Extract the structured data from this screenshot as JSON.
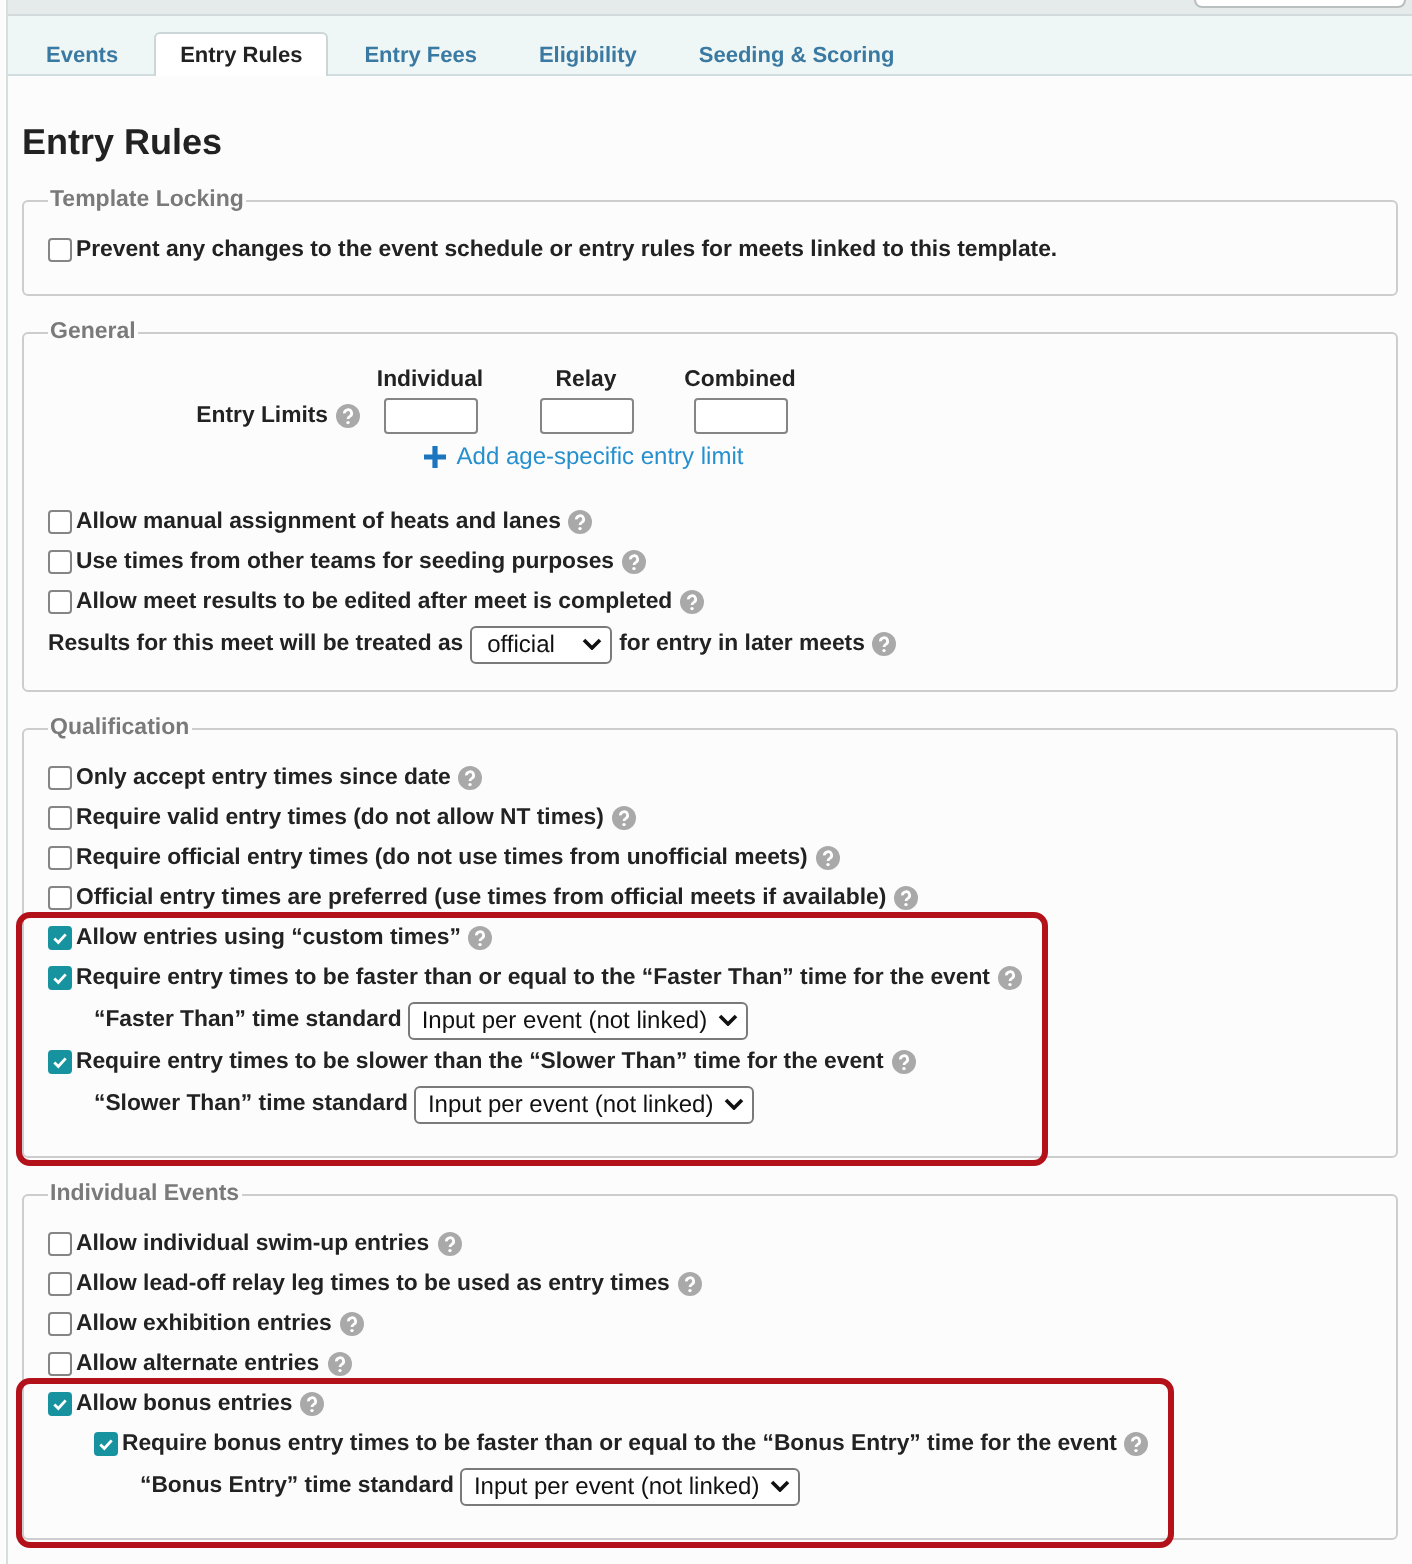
{
  "tabs": [
    {
      "label": "Events",
      "selected": false
    },
    {
      "label": "Entry Rules",
      "selected": true
    },
    {
      "label": "Entry Fees",
      "selected": false
    },
    {
      "label": "Eligibility",
      "selected": false
    },
    {
      "label": "Seeding & Scoring",
      "selected": false
    }
  ],
  "heading": "Entry Rules",
  "sections": [
    {
      "legend": "Template Locking",
      "groups": [
        {
          "highlighted": false,
          "rows": [
            {
              "kind": "checkbox",
              "label": "Prevent any changes to the event schedule or entry rules for meets linked to this template.",
              "checked": false,
              "help": false
            }
          ]
        }
      ]
    },
    {
      "legend": "General",
      "groups": [
        {
          "highlighted": false,
          "rows": [
            {
              "kind": "entry_limits",
              "label": "Entry Limits",
              "help": true,
              "columns": [
                {
                  "heading": "Individual"
                },
                {
                  "heading": "Relay"
                },
                {
                  "heading": "Combined"
                }
              ],
              "link": "Add age-specific entry limit"
            },
            {
              "kind": "checkbox",
              "label": "Allow manual assignment of heats and lanes",
              "checked": false,
              "help": true
            },
            {
              "kind": "checkbox",
              "label": "Use times from other teams for seeding purposes",
              "checked": false,
              "help": true
            },
            {
              "kind": "checkbox",
              "label": "Allow meet results to be edited after meet is completed",
              "checked": false,
              "help": true
            },
            {
              "kind": "inline_select",
              "before": "Results for this meet will be treated as",
              "value": "official",
              "after": "for entry in later meets",
              "help": true
            }
          ]
        }
      ]
    },
    {
      "legend": "Qualification",
      "groups": [
        {
          "highlighted": false,
          "rows": [
            {
              "kind": "checkbox",
              "label": "Only accept entry times since date",
              "checked": false,
              "help": true
            },
            {
              "kind": "checkbox",
              "label": "Require valid entry times (do not allow NT times)",
              "checked": false,
              "help": true
            },
            {
              "kind": "checkbox",
              "label": "Require official entry times (do not use times from unofficial meets)",
              "checked": false,
              "help": true
            },
            {
              "kind": "checkbox",
              "label": "Official entry times are preferred (use times from official meets if available)",
              "checked": false,
              "help": true
            }
          ]
        },
        {
          "highlighted": true,
          "rows": [
            {
              "kind": "checkbox",
              "label": "Allow entries using “custom times”",
              "checked": true,
              "help": true
            },
            {
              "kind": "checkbox",
              "label": "Require entry times to be faster than or equal to the “Faster Than” time for the event",
              "checked": true,
              "help": true,
              "children": [
                {
                  "kind": "select",
                  "label": "“Faster Than” time standard",
                  "value": "Input per event (not linked)"
                }
              ]
            },
            {
              "kind": "checkbox",
              "label": "Require entry times to be slower than the “Slower Than” time for the event",
              "checked": true,
              "help": true,
              "children": [
                {
                  "kind": "select",
                  "label": "“Slower Than” time standard",
                  "value": "Input per event (not linked)"
                }
              ]
            }
          ]
        }
      ]
    },
    {
      "legend": "Individual Events",
      "groups": [
        {
          "highlighted": false,
          "rows": [
            {
              "kind": "checkbox",
              "label": "Allow individual swim-up entries",
              "checked": false,
              "help": true
            },
            {
              "kind": "checkbox",
              "label": "Allow lead-off relay leg times to be used as entry times",
              "checked": false,
              "help": true
            },
            {
              "kind": "checkbox",
              "label": "Allow exhibition entries",
              "checked": false,
              "help": true
            },
            {
              "kind": "checkbox",
              "label": "Allow alternate entries",
              "checked": false,
              "help": true
            }
          ]
        },
        {
          "highlighted": true,
          "rows": [
            {
              "kind": "checkbox",
              "label": "Allow bonus entries",
              "checked": true,
              "help": true,
              "children": [
                {
                  "kind": "checkbox",
                  "label": "Require bonus entry times to be faster than or equal to the “Bonus Entry” time for the event",
                  "checked": true,
                  "help": true,
                  "children": [
                    {
                      "kind": "select",
                      "label": "“Bonus Entry” time standard",
                      "value": "Input per event (not linked)"
                    }
                  ]
                }
              ]
            }
          ]
        }
      ]
    }
  ]
}
